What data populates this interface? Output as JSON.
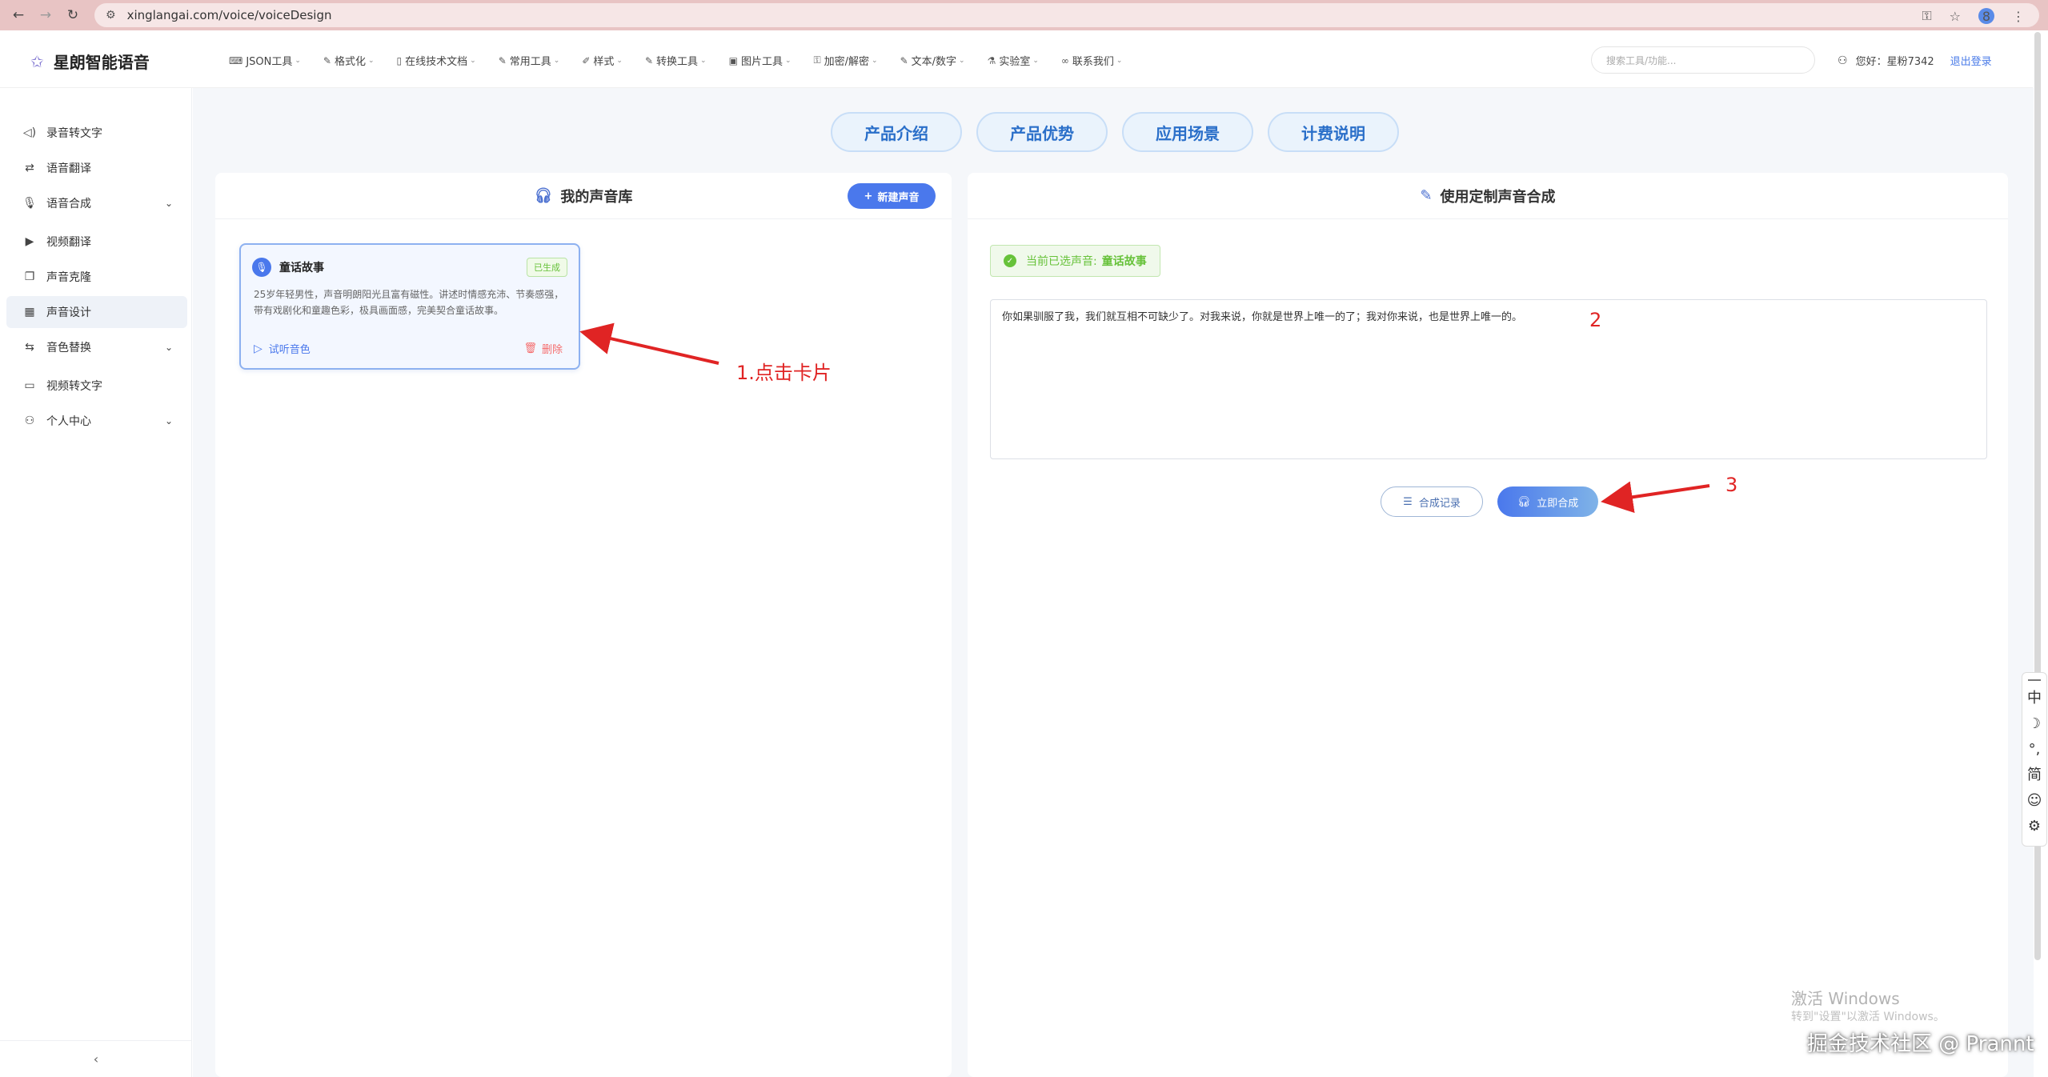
{
  "browser": {
    "url": "xinglangai.com/voice/voiceDesign",
    "profile_initial": "8"
  },
  "header": {
    "brand": "星朗智能语音",
    "menu": [
      {
        "label": "JSON工具",
        "icon": "code-icon"
      },
      {
        "label": "格式化",
        "icon": "edit-icon"
      },
      {
        "label": "在线技术文档",
        "icon": "document-icon"
      },
      {
        "label": "常用工具",
        "icon": "edit-icon"
      },
      {
        "label": "样式",
        "icon": "brush-icon"
      },
      {
        "label": "转换工具",
        "icon": "edit-icon"
      },
      {
        "label": "图片工具",
        "icon": "image-icon"
      },
      {
        "label": "加密/解密",
        "icon": "lock-icon"
      },
      {
        "label": "文本/数字",
        "icon": "edit-icon"
      },
      {
        "label": "实验室",
        "icon": "flask-icon"
      },
      {
        "label": "联系我们",
        "icon": "link-icon"
      }
    ],
    "search_placeholder": "搜索工具/功能...",
    "greeting": "您好：星粉7342",
    "logout": "退出登录"
  },
  "sidebar": {
    "items": [
      {
        "label": "录音转文字",
        "icon": "speaker-icon",
        "expandable": false,
        "active": false
      },
      {
        "label": "语音翻译",
        "icon": "translate-icon",
        "expandable": false,
        "active": false
      },
      {
        "label": "语音合成",
        "icon": "microphone-icon",
        "expandable": true,
        "active": false
      },
      {
        "label": "视频翻译",
        "icon": "video-icon",
        "expandable": false,
        "active": false
      },
      {
        "label": "声音克隆",
        "icon": "copy-icon",
        "expandable": false,
        "active": false
      },
      {
        "label": "声音设计",
        "icon": "design-icon",
        "expandable": false,
        "active": true
      },
      {
        "label": "音色替换",
        "icon": "swap-icon",
        "expandable": true,
        "active": false
      },
      {
        "label": "视频转文字",
        "icon": "video-text-icon",
        "expandable": false,
        "active": false
      },
      {
        "label": "个人中心",
        "icon": "user-icon",
        "expandable": true,
        "active": false
      }
    ]
  },
  "tabs": [
    "产品介绍",
    "产品优势",
    "应用场景",
    "计费说明"
  ],
  "library": {
    "title": "我的声音库",
    "new_button": "新建声音",
    "card": {
      "name": "童话故事",
      "status": "已生成",
      "description": "25岁年轻男性，声音明朗阳光且富有磁性。讲述时情感充沛、节奏感强，带有戏剧化和童趣色彩，极具画面感，完美契合童话故事。",
      "listen": "试听音色",
      "delete": "删除"
    }
  },
  "synthesis": {
    "title": "使用定制声音合成",
    "selected_label": "当前已选声音:",
    "selected_name": "童话故事",
    "text": "你如果驯服了我，我们就互相不可缺少了。对我来说，你就是世界上唯一的了；我对你来说，也是世界上唯一的。",
    "history_button": "合成记录",
    "synth_button": "立即合成"
  },
  "annotations": {
    "step1": "1.点击卡片",
    "step2": "2",
    "step3": "3",
    "color": "#e02424"
  },
  "ime": [
    "中",
    "☽",
    "°,",
    "简",
    "☺",
    "⚙"
  ],
  "watermark": {
    "line1": "激活 Windows",
    "line2": "转到\"设置\"以激活 Windows。",
    "credit": "掘金技术社区 @ Prannt"
  }
}
